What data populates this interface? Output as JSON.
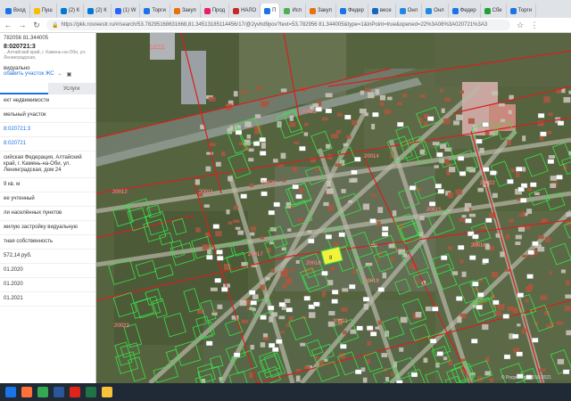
{
  "browser": {
    "tabs": [
      {
        "label": "Вход"
      },
      {
        "label": "Пуш"
      },
      {
        "label": "(2) К"
      },
      {
        "label": "(2) К"
      },
      {
        "label": "(1) W"
      },
      {
        "label": "Торги"
      },
      {
        "label": "Закуп"
      },
      {
        "label": "Прод"
      },
      {
        "label": "НАЛО"
      },
      {
        "label": "П"
      },
      {
        "label": "Исп"
      },
      {
        "label": "Закуп"
      },
      {
        "label": "Федер"
      },
      {
        "label": "весе"
      },
      {
        "label": "Онл"
      },
      {
        "label": "Онл"
      },
      {
        "label": "Федер"
      },
      {
        "label": "Сбе"
      },
      {
        "label": "Торги"
      }
    ],
    "url": "https://pkk.rosreestr.ru/#/search/53.78295168631668,81.34513185114456/17/@2yvhd9pov?text=53.782956 81.344005&type=1&inPoint=true&opened=22%3A08%3A020721%3A3"
  },
  "panel": {
    "search_text": "782056 81.344005",
    "cadastral_number": "8:020721:3",
    "address_short": "...Алтайский край, г. Камень-на-Оби, ул. Ленинградская,",
    "usage": "видуально",
    "add_link": "обавить участок ЖС",
    "tab_info": "",
    "tab_services": "Услуги",
    "rows": [
      {
        "text": "ект недвижимости",
        "blue": false
      },
      {
        "text": "мельный участок",
        "blue": false
      },
      {
        "text": "8:020721:3",
        "blue": true
      },
      {
        "text": "8:020721",
        "blue": true
      },
      {
        "text": "сийская Федерация, Алтайский край, г. Камень-на-Оби, ул. Ленинградская, дом 24",
        "blue": false
      },
      {
        "text": "9 кв. м",
        "blue": false
      },
      {
        "text": "ее учтенный",
        "blue": false
      },
      {
        "text": "ли населённых пунктов",
        "blue": false
      },
      {
        "text": "жилую застройку видуальную",
        "blue": false
      },
      {
        "text": "тная собственность",
        "blue": false
      },
      {
        "text": "572,14 руб.",
        "blue": false
      },
      {
        "text": "01.2020",
        "blue": false
      },
      {
        "text": "01.2020",
        "blue": false
      },
      {
        "text": "01.2021",
        "blue": false
      }
    ]
  },
  "map": {
    "quarter_labels": [
      "20010",
      "20012",
      "20011",
      "20020",
      "20013",
      "20014",
      "20015",
      "20016",
      "20017",
      "20018",
      "20019",
      "20021",
      "20022",
      "20023"
    ],
    "selected_label": "8",
    "copyright": "© Росреестр, 2010-2021"
  },
  "colors": {
    "parcel_green": "#3be04b",
    "quarter_red": "#d62020",
    "selected_yellow": "#f3f23a",
    "road": "#b9b9a8"
  },
  "taskbar": {
    "items": [
      "start",
      "firefox",
      "chrome",
      "word",
      "pdf",
      "excel",
      "explorer"
    ]
  }
}
